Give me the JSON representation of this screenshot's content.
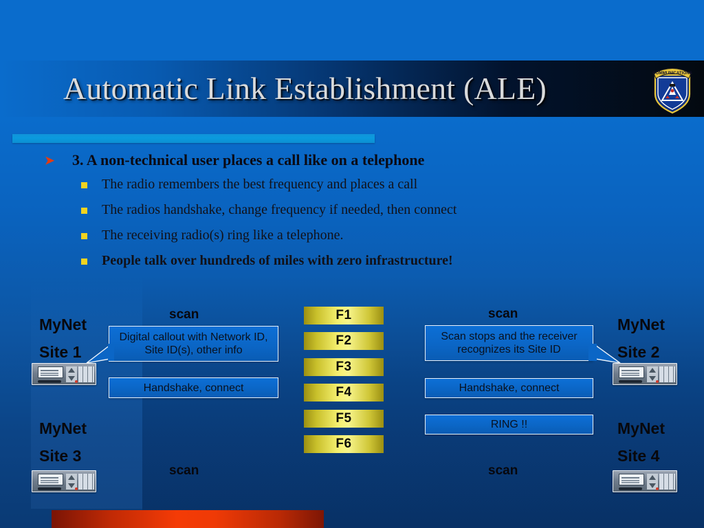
{
  "slide": {
    "title": "Automatic Link Establishment (ALE)",
    "badge_text": "COMMUNICATIONS"
  },
  "bullets": {
    "level1": "3.  A non-technical user places a call like on a telephone",
    "level1_marker": "arrow-bullet-icon",
    "level2": [
      {
        "text": "The radio remembers the best frequency and places a call",
        "bold": false
      },
      {
        "text": "The radios handshake, change frequency if needed, then connect",
        "bold": false
      },
      {
        "text": "The receiving radio(s) ring like a telephone.",
        "bold": false
      },
      {
        "text": "People talk over hundreds of miles with zero infrastructure!",
        "bold": true
      }
    ]
  },
  "diagram": {
    "sites": [
      {
        "name": "MyNet",
        "id": "Site 1"
      },
      {
        "name": "MyNet",
        "id": "Site 2"
      },
      {
        "name": "MyNet",
        "id": "Site 3"
      },
      {
        "name": "MyNet",
        "id": "Site 4"
      }
    ],
    "scan_labels": [
      "scan",
      "scan",
      "scan",
      "scan"
    ],
    "callouts": {
      "left_top": "Digital callout with Network ID, Site ID(s), other info",
      "left_mid": "Handshake, connect",
      "right_top": "Scan stops and the receiver recognizes its Site ID",
      "right_mid": "Handshake, connect",
      "right_bottom": "RING !!"
    },
    "frequencies": [
      "F1",
      "F2",
      "F3",
      "F4",
      "F5",
      "F6"
    ]
  },
  "colors": {
    "background_top": "#0a6ccc",
    "background_bottom": "#0a3a74",
    "accent_bar": "#0a9ade",
    "callout_fill": "#0b66c6",
    "callout_border": "#eaf2fb",
    "frequency_bar": "#f4ef6e",
    "red_bar": "#f43b06",
    "title_text": "#d9dadb",
    "bullet_square": "#f2d320",
    "bullet_arrow": "#e33c12"
  }
}
